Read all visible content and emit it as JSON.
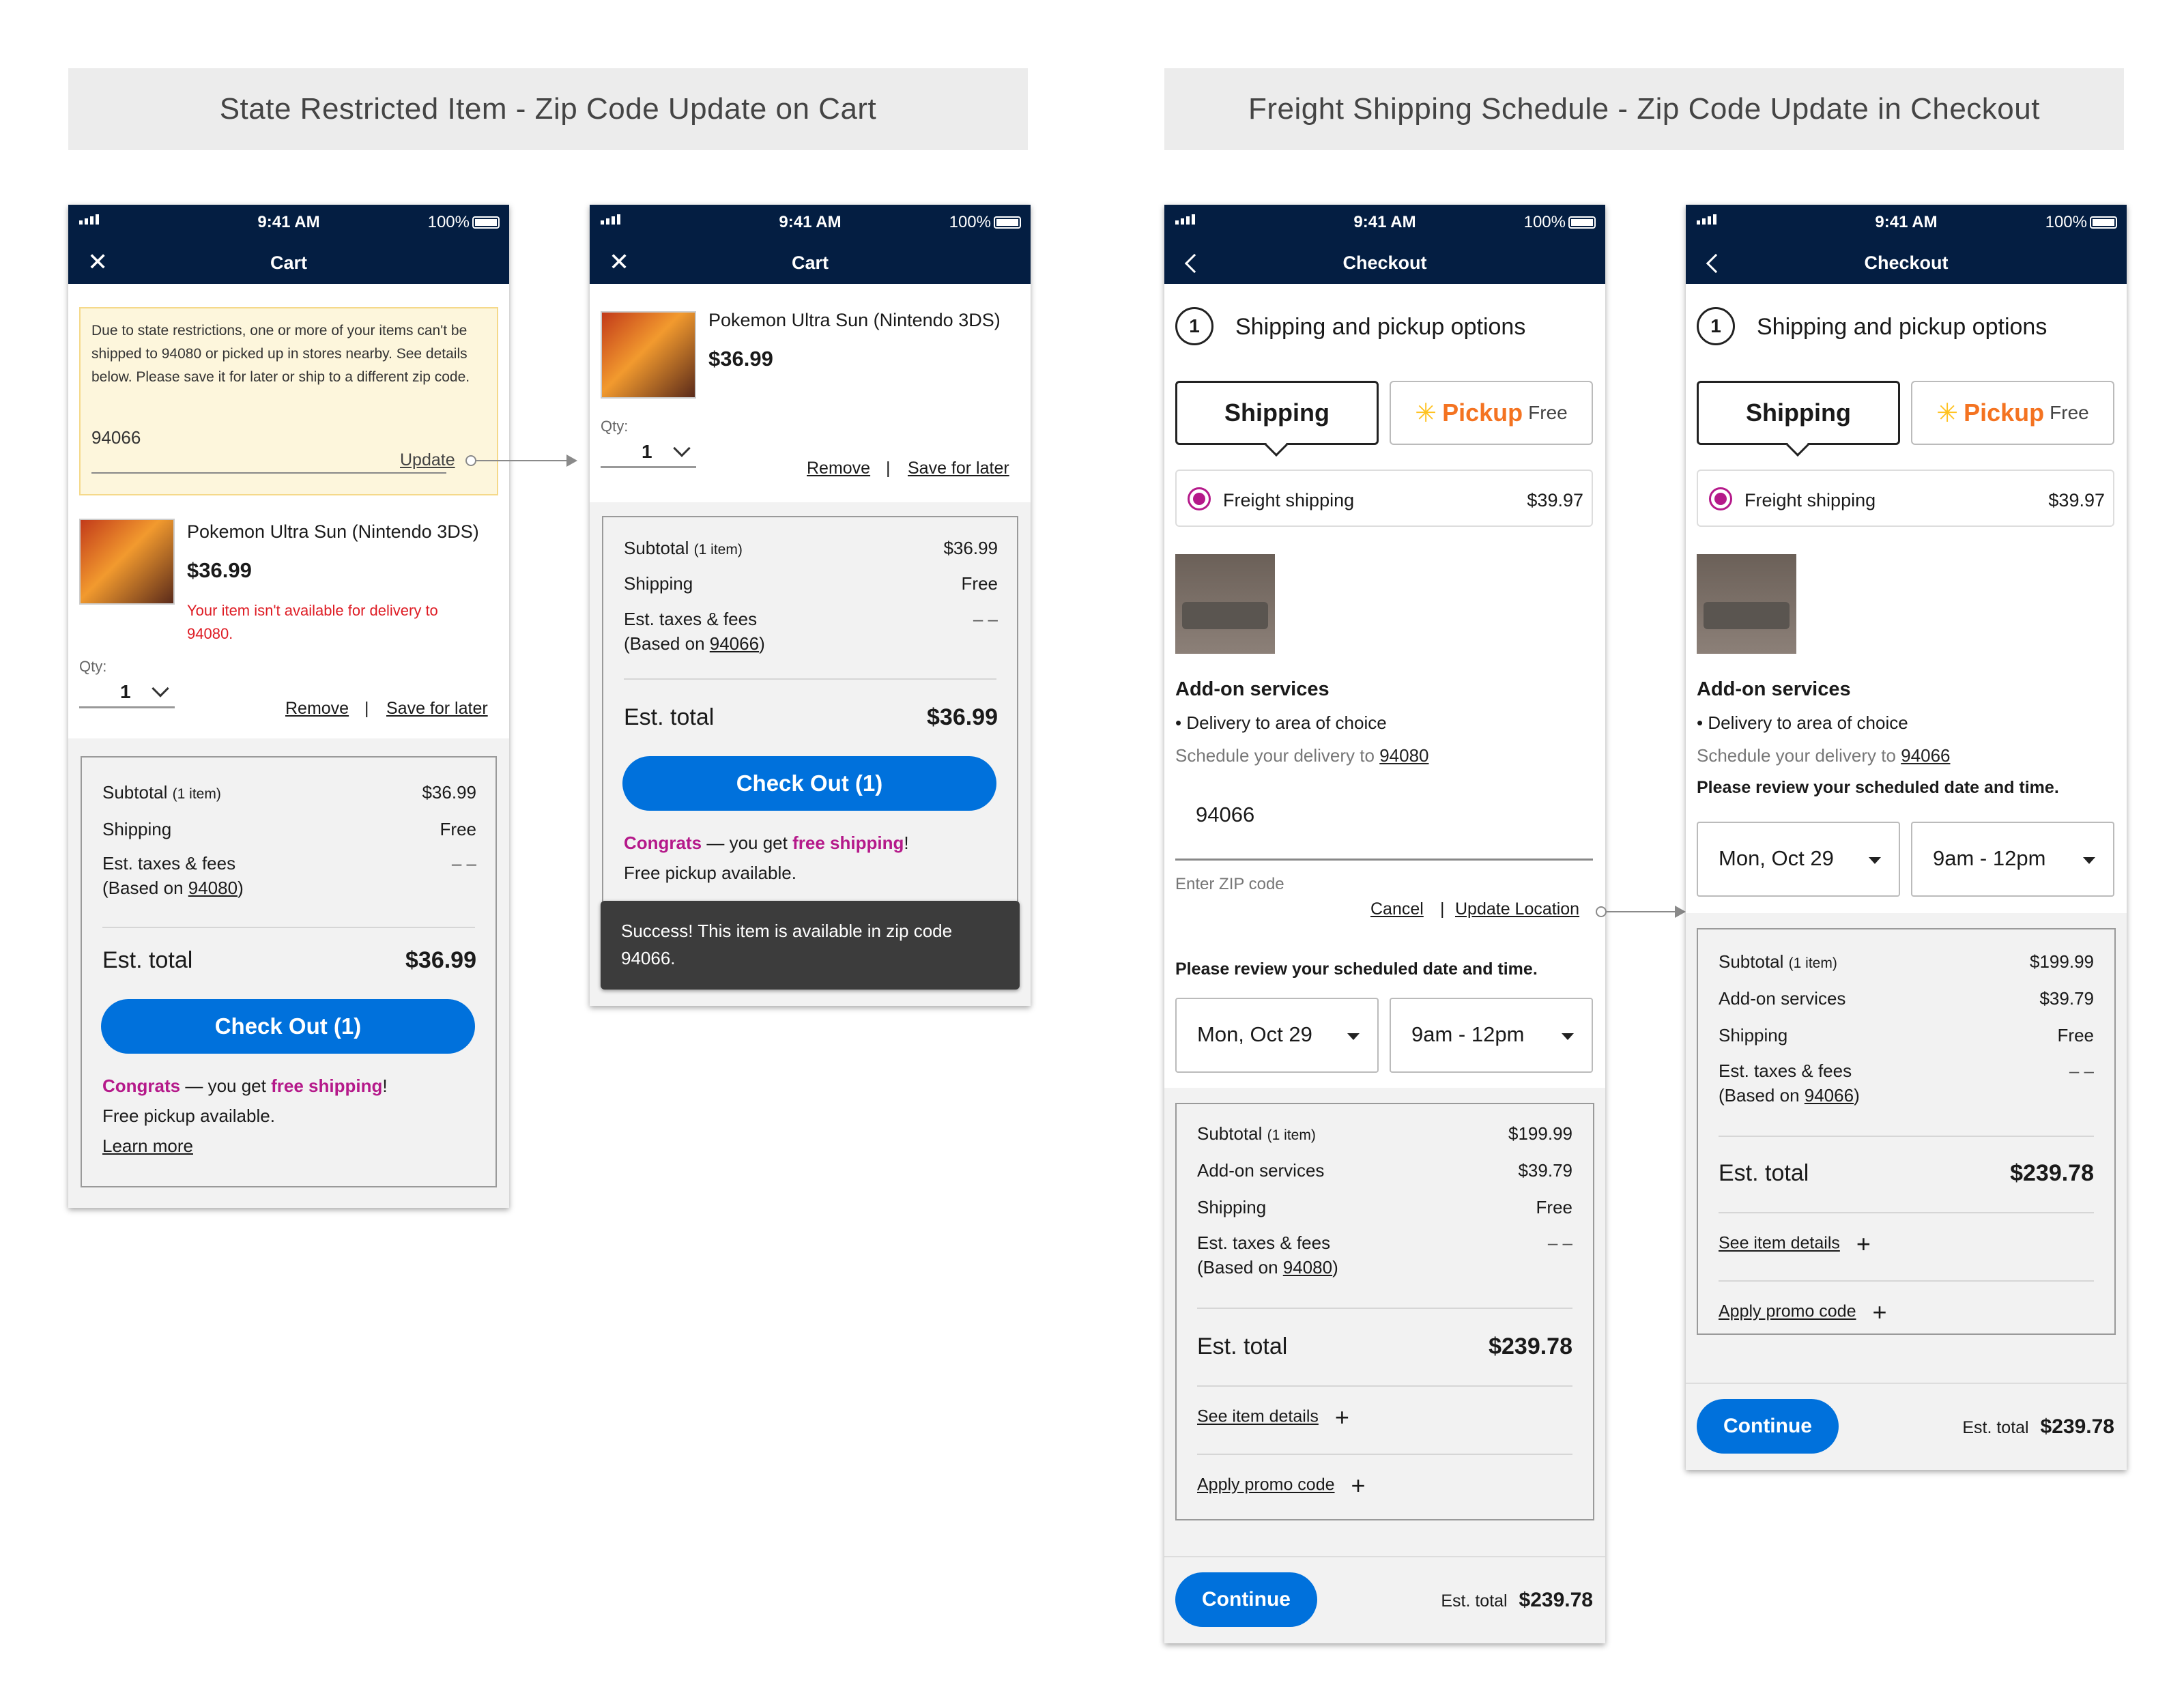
{
  "banners": {
    "left": "State Restricted Item - Zip Code Update on Cart",
    "right": "Freight Shipping Schedule - Zip Code Update in Checkout"
  },
  "status": {
    "time": "9:41 AM",
    "battery": "100%"
  },
  "cart1": {
    "title": "Cart",
    "alert": "Due to state restrictions, one or more of your items can't be shipped to 94080 or picked up in stores nearby. See details below. Please save it for later or ship to a different zip code.",
    "zip_value": "94066",
    "update_link": "Update",
    "product_name": "Pokemon Ultra Sun (Nintendo 3DS)",
    "price": "$36.99",
    "error": "Your item isn't available for delivery to 94080.",
    "qty_label": "Qty:",
    "qty": "1",
    "remove": "Remove",
    "sep": "|",
    "save_later": "Save for later",
    "subtotal_label": "Subtotal",
    "subtotal_items": "(1 item)",
    "subtotal": "$36.99",
    "shipping_label": "Shipping",
    "shipping": "Free",
    "taxes_label": "Est. taxes & fees",
    "based_on": "(Based on",
    "based_zip": "94080",
    "based_close": ")",
    "taxes": "– –",
    "est_total_label": "Est. total",
    "est_total": "$36.99",
    "checkout": "Check Out (1)",
    "congrats": "Congrats",
    "congrats_mid": " — you get ",
    "free_shipping": "free shipping",
    "bang": "!",
    "pickup": "Free pickup available.",
    "learn_more": "Learn more"
  },
  "cart2": {
    "title": "Cart",
    "product_name": "Pokemon Ultra Sun (Nintendo 3DS)",
    "price": "$36.99",
    "qty_label": "Qty:",
    "qty": "1",
    "remove": "Remove",
    "sep": "|",
    "save_later": "Save for later",
    "subtotal_label": "Subtotal",
    "subtotal_items": "(1 item)",
    "subtotal": "$36.99",
    "shipping_label": "Shipping",
    "shipping": "Free",
    "taxes_label": "Est. taxes & fees",
    "based_on": "(Based on",
    "based_zip": "94066",
    "based_close": ")",
    "taxes": "– –",
    "est_total_label": "Est. total",
    "est_total": "$36.99",
    "checkout": "Check Out (1)",
    "congrats": "Congrats",
    "congrats_mid": " — you get ",
    "free_shipping": "free shipping",
    "bang": "!",
    "pickup": "Free pickup available.",
    "toast": "Success! This item is available in zip code 94066."
  },
  "checkout1": {
    "title": "Checkout",
    "step_num": "1",
    "step_title": "Shipping and pickup options",
    "tab_shipping": "Shipping",
    "tab_pickup": "Pickup",
    "tab_pickup_free": "Free",
    "freight_label": "Freight shipping",
    "freight_price": "$39.97",
    "addon_title": "Add-on services",
    "addon_item": "• Delivery to area of choice",
    "schedule_text": "Schedule your delivery to",
    "schedule_zip": "94080",
    "zip_input": "94066",
    "zip_helper": "Enter ZIP code",
    "cancel": "Cancel",
    "sep": "|",
    "update_location": "Update Location",
    "review": "Please review your scheduled date and time.",
    "date": "Mon, Oct 29",
    "time": "9am - 12pm",
    "subtotal_label": "Subtotal",
    "subtotal_items": "(1 item)",
    "subtotal": "$199.99",
    "addon_label": "Add-on services",
    "addon_price": "$39.79",
    "shipping_label": "Shipping",
    "shipping": "Free",
    "taxes_label": "Est. taxes & fees",
    "based_on": "(Based on",
    "based_zip": "94080",
    "based_close": ")",
    "taxes": "– –",
    "est_total_label": "Est. total",
    "est_total": "$239.78",
    "see_details": "See item details",
    "promo": "Apply promo code",
    "continue": "Continue",
    "footer_label": "Est. total",
    "footer_total": "$239.78"
  },
  "checkout2": {
    "title": "Checkout",
    "step_num": "1",
    "step_title": "Shipping and pickup options",
    "tab_shipping": "Shipping",
    "tab_pickup": "Pickup",
    "tab_pickup_free": "Free",
    "freight_label": "Freight shipping",
    "freight_price": "$39.97",
    "addon_title": "Add-on services",
    "addon_item": "• Delivery to area of choice",
    "schedule_text": "Schedule your delivery to",
    "schedule_zip": "94066",
    "review": "Please review your scheduled date and time.",
    "date": "Mon, Oct 29",
    "time": "9am - 12pm",
    "subtotal_label": "Subtotal",
    "subtotal_items": "(1 item)",
    "subtotal": "$199.99",
    "addon_label": "Add-on services",
    "addon_price": "$39.79",
    "shipping_label": "Shipping",
    "shipping": "Free",
    "taxes_label": "Est. taxes & fees",
    "based_on": "(Based on",
    "based_zip": "94066",
    "based_close": ")",
    "taxes": "– –",
    "est_total_label": "Est. total",
    "est_total": "$239.78",
    "see_details": "See item details",
    "promo": "Apply promo code",
    "continue": "Continue",
    "footer_label": "Est. total",
    "footer_total": "$239.78"
  },
  "colors": {
    "navy": "#041e42",
    "blue": "#0071dc",
    "pink": "#b5198a",
    "orange": "#f47321",
    "error": "#de1c24"
  }
}
